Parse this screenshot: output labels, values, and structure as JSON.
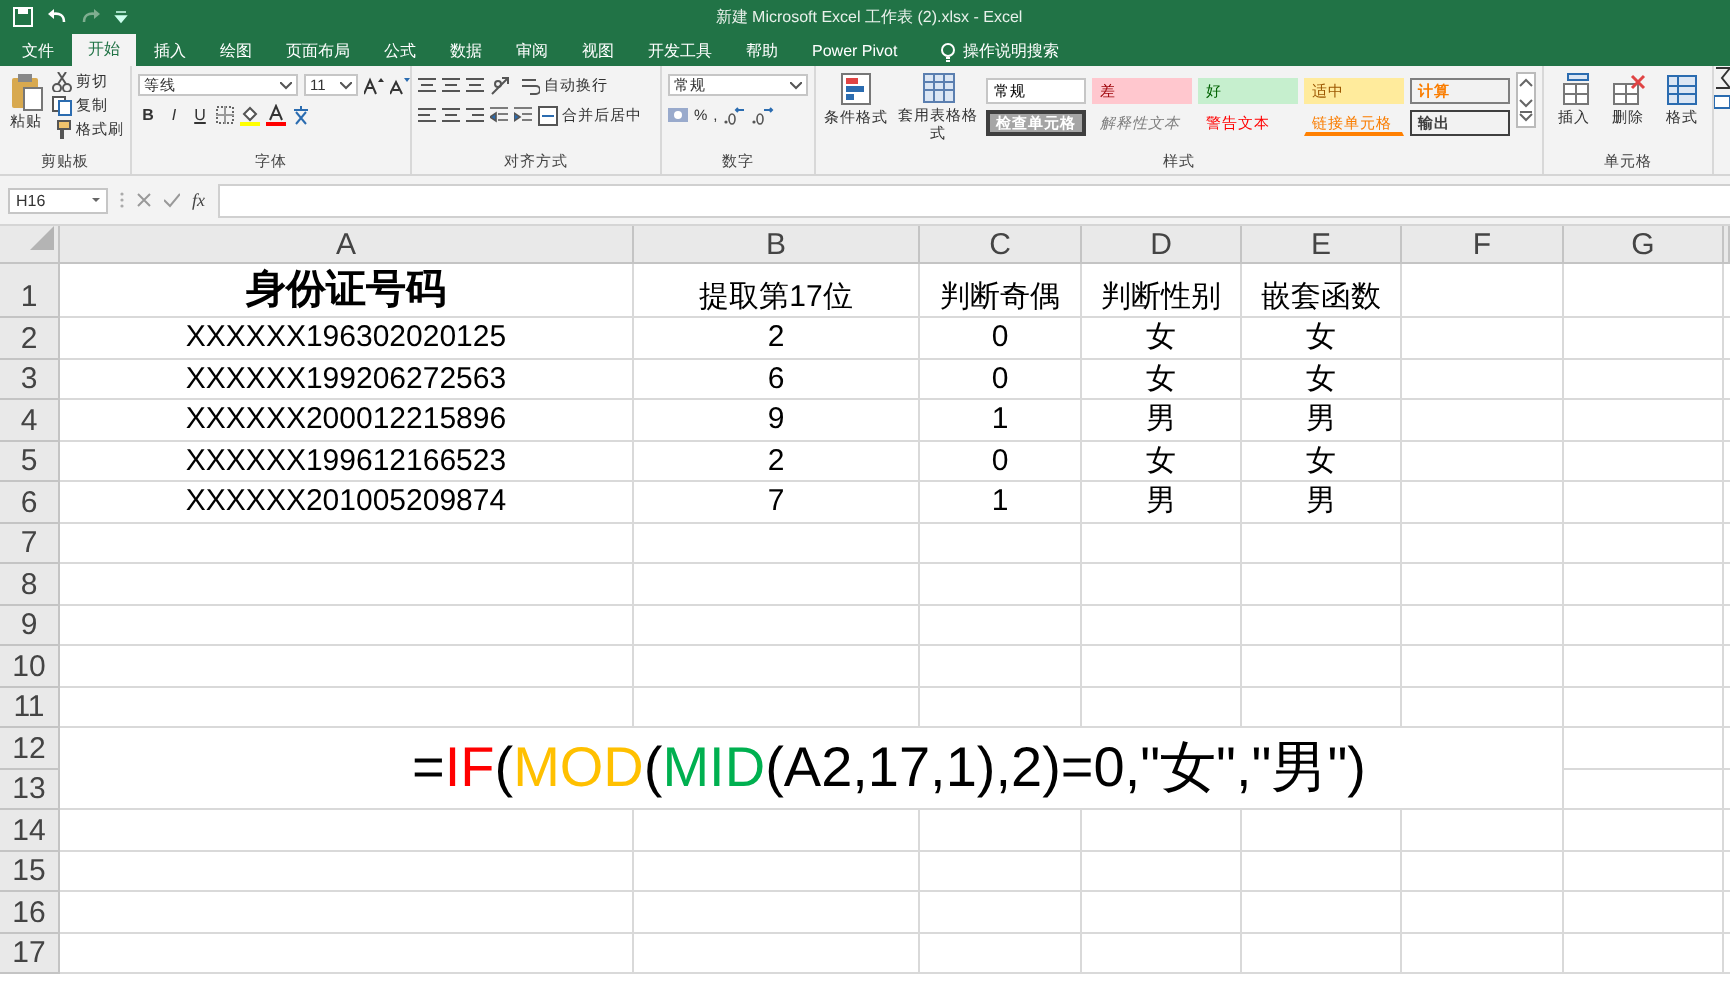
{
  "title": "新建 Microsoft Excel 工作表 (2).xlsx  -  Excel",
  "tabs": [
    {
      "label": "文件",
      "selected": false
    },
    {
      "label": "开始",
      "selected": true
    },
    {
      "label": "插入",
      "selected": false
    },
    {
      "label": "绘图",
      "selected": false
    },
    {
      "label": "页面布局",
      "selected": false
    },
    {
      "label": "公式",
      "selected": false
    },
    {
      "label": "数据",
      "selected": false
    },
    {
      "label": "审阅",
      "selected": false
    },
    {
      "label": "视图",
      "selected": false
    },
    {
      "label": "开发工具",
      "selected": false
    },
    {
      "label": "帮助",
      "selected": false
    },
    {
      "label": "Power Pivot",
      "selected": false
    }
  ],
  "tell_me": "操作说明搜索",
  "clipboard": {
    "label": "剪贴板",
    "paste": "粘贴",
    "cut": "剪切",
    "copy": "复制",
    "format_painter": "格式刷"
  },
  "font": {
    "label": "字体",
    "name": "等线",
    "size": "11",
    "bold": "B",
    "italic": "I",
    "underline": "U"
  },
  "alignment": {
    "label": "对齐方式",
    "wrap": "自动换行",
    "merge": "合并后居中"
  },
  "number": {
    "label": "数字",
    "format": "常规",
    "percent": "%",
    "comma": ","
  },
  "styles": {
    "label": "样式",
    "conditional": "条件格式",
    "table": "套用表格格式",
    "cell_styles": [
      {
        "label": "常规",
        "kind": "normal"
      },
      {
        "label": "差",
        "kind": "bad"
      },
      {
        "label": "好",
        "kind": "good"
      },
      {
        "label": "适中",
        "kind": "neutral"
      },
      {
        "label": "计算",
        "kind": "calculation"
      },
      {
        "label": "检查单元格",
        "kind": "check"
      },
      {
        "label": "解释性文本",
        "kind": "explanatory"
      },
      {
        "label": "警告文本",
        "kind": "warning"
      },
      {
        "label": "链接单元格",
        "kind": "linked"
      },
      {
        "label": "输出",
        "kind": "output"
      }
    ]
  },
  "cells": {
    "label": "单元格",
    "insert": "插入",
    "delete": "删除",
    "format": "格式"
  },
  "name_box": "H16",
  "function_label": "fx",
  "sheet": {
    "columns": [
      "A",
      "B",
      "C",
      "D",
      "E",
      "F",
      "G"
    ],
    "row_numbers": [
      "1",
      "2",
      "3",
      "4",
      "5",
      "6",
      "7",
      "8",
      "9",
      "10",
      "11",
      "12",
      "13",
      "14",
      "15",
      "16",
      "17"
    ],
    "header": [
      "身份证号码",
      "提取第17位",
      "判断奇偶",
      "判断性别",
      "嵌套函数"
    ],
    "rows": [
      [
        "XXXXXX196302020125",
        "2",
        "0",
        "女",
        "女"
      ],
      [
        "XXXXXX199206272563",
        "6",
        "0",
        "女",
        "女"
      ],
      [
        "XXXXXX200012215896",
        "9",
        "1",
        "男",
        "男"
      ],
      [
        "XXXXXX199612166523",
        "2",
        "0",
        "女",
        "女"
      ],
      [
        "XXXXXX201005209874",
        "7",
        "1",
        "男",
        "男"
      ]
    ],
    "formula": [
      {
        "text": "=",
        "color": "#000000"
      },
      {
        "text": "IF",
        "color": "#ff0000"
      },
      {
        "text": "(",
        "color": "#000000"
      },
      {
        "text": "MOD",
        "color": "#ffc000"
      },
      {
        "text": "(",
        "color": "#000000"
      },
      {
        "text": "MID",
        "color": "#00b050"
      },
      {
        "text": "(A2,17,1),2)=0,\"女\",\"男\")",
        "color": "#000000"
      }
    ]
  }
}
